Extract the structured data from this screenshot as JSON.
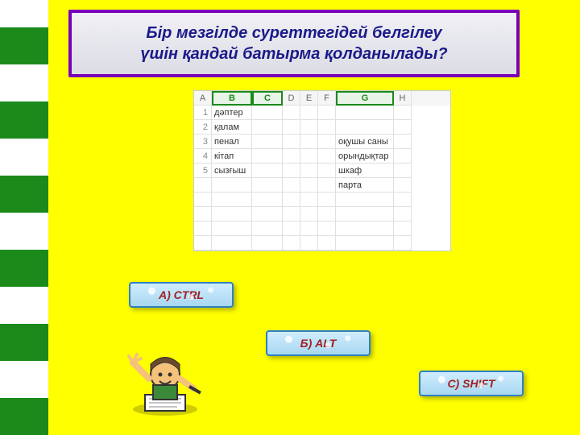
{
  "question": {
    "line1": "Бір мезгілде суреттегідей белгілеу",
    "line2": "үшін қандай батырма қолданылады?"
  },
  "sheet": {
    "headers": [
      "A",
      "B",
      "C",
      "D",
      "E",
      "F",
      "G",
      "H"
    ],
    "selected_headers": [
      "B",
      "C",
      "G"
    ],
    "rows": [
      {
        "n": "1",
        "b": "дәптер",
        "g": ""
      },
      {
        "n": "2",
        "b": "қалам",
        "g": ""
      },
      {
        "n": "3",
        "b": "пенал",
        "g": "оқушы саны"
      },
      {
        "n": "4",
        "b": "кітап",
        "g": "орындықтар"
      },
      {
        "n": "5",
        "b": "сызғыш",
        "g": "шкаф"
      },
      {
        "n": "",
        "b": "",
        "g": "парта"
      }
    ]
  },
  "answers": {
    "a": "А) CTRL",
    "b": "Б) ALT",
    "c": "С) SHIFT"
  }
}
